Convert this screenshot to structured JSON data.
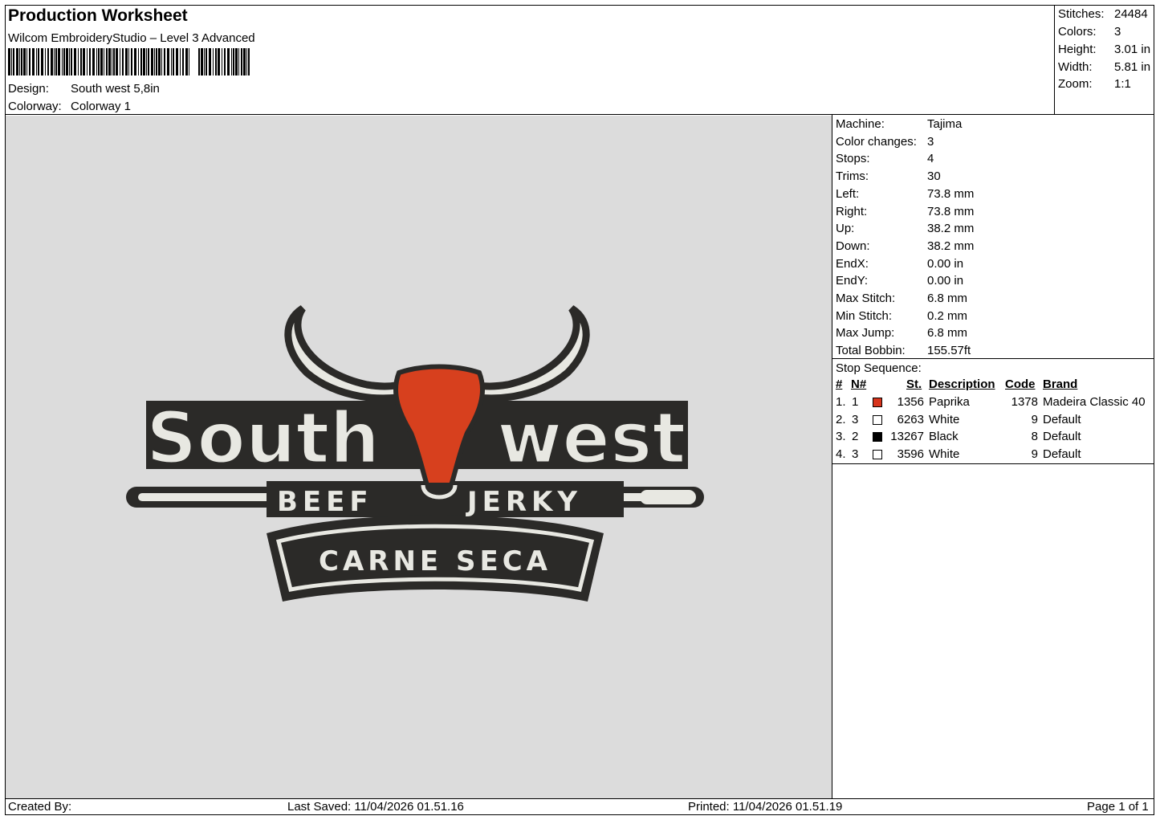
{
  "header": {
    "title": "Production Worksheet",
    "software": "Wilcom EmbroideryStudio – Level 3 Advanced",
    "design_label": "Design:",
    "design_value": "South west 5,8in",
    "colorway_label": "Colorway:",
    "colorway_value": "Colorway 1"
  },
  "summary": {
    "stitches_label": "Stitches:",
    "stitches_value": "24484",
    "colors_label": "Colors:",
    "colors_value": "3",
    "height_label": "Height:",
    "height_value": "3.01 in",
    "width_label": "Width:",
    "width_value": "5.81 in",
    "zoom_label": "Zoom:",
    "zoom_value": "1:1"
  },
  "machine": [
    {
      "label": "Machine:",
      "value": "Tajima"
    },
    {
      "label": "Color changes:",
      "value": "3"
    },
    {
      "label": "Stops:",
      "value": "4"
    },
    {
      "label": "Trims:",
      "value": "30"
    },
    {
      "label": "Left:",
      "value": "73.8 mm"
    },
    {
      "label": "Right:",
      "value": "73.8 mm"
    },
    {
      "label": "Up:",
      "value": "38.2 mm"
    },
    {
      "label": "Down:",
      "value": "38.2 mm"
    },
    {
      "label": "EndX:",
      "value": "0.00 in"
    },
    {
      "label": "EndY:",
      "value": "0.00 in"
    },
    {
      "label": "Max Stitch:",
      "value": "6.8 mm"
    },
    {
      "label": "Min Stitch:",
      "value": "0.2 mm"
    },
    {
      "label": "Max Jump:",
      "value": "6.8 mm"
    },
    {
      "label": "Total Bobbin:",
      "value": "155.57ft"
    }
  ],
  "stop_sequence": {
    "title": "Stop Sequence:",
    "columns": {
      "num": "#",
      "n": "N#",
      "st": "St.",
      "description": "Description",
      "code": "Code",
      "brand": "Brand"
    },
    "rows": [
      {
        "num": "1.",
        "n": "1",
        "color": "#d7341c",
        "st": "1356",
        "description": "Paprika",
        "code": "1378",
        "brand": "Madeira Classic 40"
      },
      {
        "num": "2.",
        "n": "3",
        "color": "#ffffff",
        "st": "6263",
        "description": "White",
        "code": "9",
        "brand": "Default"
      },
      {
        "num": "3.",
        "n": "2",
        "color": "#000000",
        "st": "13267",
        "description": "Black",
        "code": "8",
        "brand": "Default"
      },
      {
        "num": "4.",
        "n": "3",
        "color": "#ffffff",
        "st": "3596",
        "description": "White",
        "code": "9",
        "brand": "Default"
      }
    ]
  },
  "logo": {
    "word_left": "South",
    "word_right": "west",
    "line2": "BEEF",
    "line2b": "JERKY",
    "banner": "CARNE SECA",
    "colors": {
      "dark": "#2b2a28",
      "light": "#e8e8e2",
      "accent": "#d7401e"
    }
  },
  "footer": {
    "created_by": "Created By:",
    "last_saved": "Last Saved: 11/04/2026 01.51.16",
    "printed": "Printed: 11/04/2026 01.51.19",
    "page": "Page 1 of 1"
  }
}
